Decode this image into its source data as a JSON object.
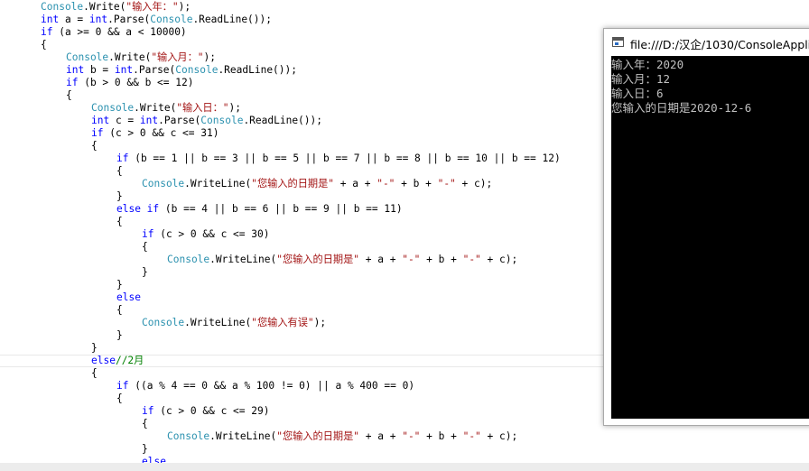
{
  "code_lines": [
    {
      "indent": 1,
      "tokens": [
        [
          "ty",
          "Console"
        ],
        [
          "",
          "."
        ],
        [
          "",
          "Write"
        ],
        [
          "",
          "("
        ],
        [
          "st",
          "\"输入年：\""
        ],
        [
          "",
          ");"
        ]
      ]
    },
    {
      "indent": 1,
      "tokens": [
        [
          "kw",
          "int"
        ],
        [
          "",
          " a = "
        ],
        [
          "kw",
          "int"
        ],
        [
          "",
          ".Parse("
        ],
        [
          "ty",
          "Console"
        ],
        [
          "",
          ".ReadLine());"
        ]
      ]
    },
    {
      "indent": 1,
      "tokens": [
        [
          "kw",
          "if"
        ],
        [
          "",
          " (a >= 0 && a < 10000)"
        ]
      ]
    },
    {
      "indent": 1,
      "tokens": [
        [
          "",
          "{"
        ]
      ]
    },
    {
      "indent": 2,
      "tokens": [
        [
          "ty",
          "Console"
        ],
        [
          "",
          ".Write("
        ],
        [
          "st",
          "\"输入月：\""
        ],
        [
          "",
          ");"
        ]
      ]
    },
    {
      "indent": 2,
      "tokens": [
        [
          "kw",
          "int"
        ],
        [
          "",
          " b = "
        ],
        [
          "kw",
          "int"
        ],
        [
          "",
          ".Parse("
        ],
        [
          "ty",
          "Console"
        ],
        [
          "",
          ".ReadLine());"
        ]
      ]
    },
    {
      "indent": 2,
      "tokens": [
        [
          "kw",
          "if"
        ],
        [
          "",
          " (b > 0 && b <= 12)"
        ]
      ]
    },
    {
      "indent": 2,
      "tokens": [
        [
          "",
          "{"
        ]
      ]
    },
    {
      "indent": 3,
      "tokens": [
        [
          "ty",
          "Console"
        ],
        [
          "",
          ".Write("
        ],
        [
          "st",
          "\"输入日：\""
        ],
        [
          "",
          ");"
        ]
      ]
    },
    {
      "indent": 3,
      "tokens": [
        [
          "kw",
          "int"
        ],
        [
          "",
          " c = "
        ],
        [
          "kw",
          "int"
        ],
        [
          "",
          ".Parse("
        ],
        [
          "ty",
          "Console"
        ],
        [
          "",
          ".ReadLine());"
        ]
      ]
    },
    {
      "indent": 3,
      "tokens": [
        [
          "kw",
          "if"
        ],
        [
          "",
          " (c > 0 && c <= 31)"
        ]
      ]
    },
    {
      "indent": 3,
      "tokens": [
        [
          "",
          "{"
        ]
      ]
    },
    {
      "indent": 4,
      "tokens": [
        [
          "kw",
          "if"
        ],
        [
          "",
          " (b == 1 || b == 3 || b == 5 || b == 7 || b == 8 || b == 10 || b == 12)"
        ]
      ]
    },
    {
      "indent": 4,
      "tokens": [
        [
          "",
          "{"
        ]
      ]
    },
    {
      "indent": 5,
      "tokens": [
        [
          "ty",
          "Console"
        ],
        [
          "",
          ".WriteLine("
        ],
        [
          "st",
          "\"您输入的日期是\""
        ],
        [
          "",
          " + a + "
        ],
        [
          "st",
          "\"-\""
        ],
        [
          "",
          " + b + "
        ],
        [
          "st",
          "\"-\""
        ],
        [
          "",
          " + c);"
        ]
      ]
    },
    {
      "indent": 4,
      "tokens": [
        [
          "",
          "}"
        ]
      ]
    },
    {
      "indent": 4,
      "tokens": [
        [
          "kw",
          "else if"
        ],
        [
          "",
          " (b == 4 || b == 6 || b == 9 || b == 11)"
        ]
      ]
    },
    {
      "indent": 4,
      "tokens": [
        [
          "",
          "{"
        ]
      ]
    },
    {
      "indent": 5,
      "tokens": [
        [
          "kw",
          "if"
        ],
        [
          "",
          " (c > 0 && c <= 30)"
        ]
      ]
    },
    {
      "indent": 5,
      "tokens": [
        [
          "",
          "{"
        ]
      ]
    },
    {
      "indent": 6,
      "tokens": [
        [
          "ty",
          "Console"
        ],
        [
          "",
          ".WriteLine("
        ],
        [
          "st",
          "\"您输入的日期是\""
        ],
        [
          "",
          " + a + "
        ],
        [
          "st",
          "\"-\""
        ],
        [
          "",
          " + b + "
        ],
        [
          "st",
          "\"-\""
        ],
        [
          "",
          " + c);"
        ]
      ]
    },
    {
      "indent": 5,
      "tokens": [
        [
          "",
          "}"
        ]
      ]
    },
    {
      "indent": 4,
      "tokens": [
        [
          "",
          "}"
        ]
      ]
    },
    {
      "indent": 4,
      "tokens": [
        [
          "kw",
          "else"
        ]
      ]
    },
    {
      "indent": 4,
      "tokens": [
        [
          "",
          "{"
        ]
      ]
    },
    {
      "indent": 5,
      "tokens": [
        [
          "ty",
          "Console"
        ],
        [
          "",
          ".WriteLine("
        ],
        [
          "st",
          "\"您输入有误\""
        ],
        [
          "",
          ");"
        ]
      ]
    },
    {
      "indent": 4,
      "tokens": [
        [
          "",
          "}"
        ]
      ]
    },
    {
      "indent": 3,
      "tokens": [
        [
          "",
          "}"
        ]
      ]
    },
    {
      "indent": 3,
      "tokens": [
        [
          "kw",
          "else"
        ],
        [
          "cm",
          "//2月"
        ]
      ]
    },
    {
      "indent": 3,
      "tokens": [
        [
          "",
          "{"
        ]
      ]
    },
    {
      "indent": 4,
      "tokens": [
        [
          "kw",
          "if"
        ],
        [
          "",
          " ((a % 4 == 0 && a % 100 != 0) || a % 400 == 0)"
        ]
      ]
    },
    {
      "indent": 4,
      "tokens": [
        [
          "",
          "{"
        ]
      ]
    },
    {
      "indent": 5,
      "tokens": [
        [
          "kw",
          "if"
        ],
        [
          "",
          " (c > 0 && c <= 29)"
        ]
      ]
    },
    {
      "indent": 5,
      "tokens": [
        [
          "",
          "{"
        ]
      ]
    },
    {
      "indent": 6,
      "tokens": [
        [
          "ty",
          "Console"
        ],
        [
          "",
          ".WriteLine("
        ],
        [
          "st",
          "\"您输入的日期是\""
        ],
        [
          "",
          " + a + "
        ],
        [
          "st",
          "\"-\""
        ],
        [
          "",
          " + b + "
        ],
        [
          "st",
          "\"-\""
        ],
        [
          "",
          " + c);"
        ]
      ]
    },
    {
      "indent": 5,
      "tokens": [
        [
          "",
          "}"
        ]
      ]
    },
    {
      "indent": 5,
      "tokens": [
        [
          "kw",
          "else"
        ]
      ]
    }
  ],
  "console": {
    "title": "file:///D:/汉企/1030/ConsoleApplic",
    "lines": [
      "输入年：2020",
      "输入月：12",
      "输入日：6",
      "您输入的日期是2020-12-6"
    ]
  },
  "colors": {
    "keyword": "#0000ff",
    "type": "#2b91af",
    "string": "#a31515",
    "comment": "#008000",
    "console_bg": "#000000",
    "console_fg": "#c0c0c0"
  }
}
